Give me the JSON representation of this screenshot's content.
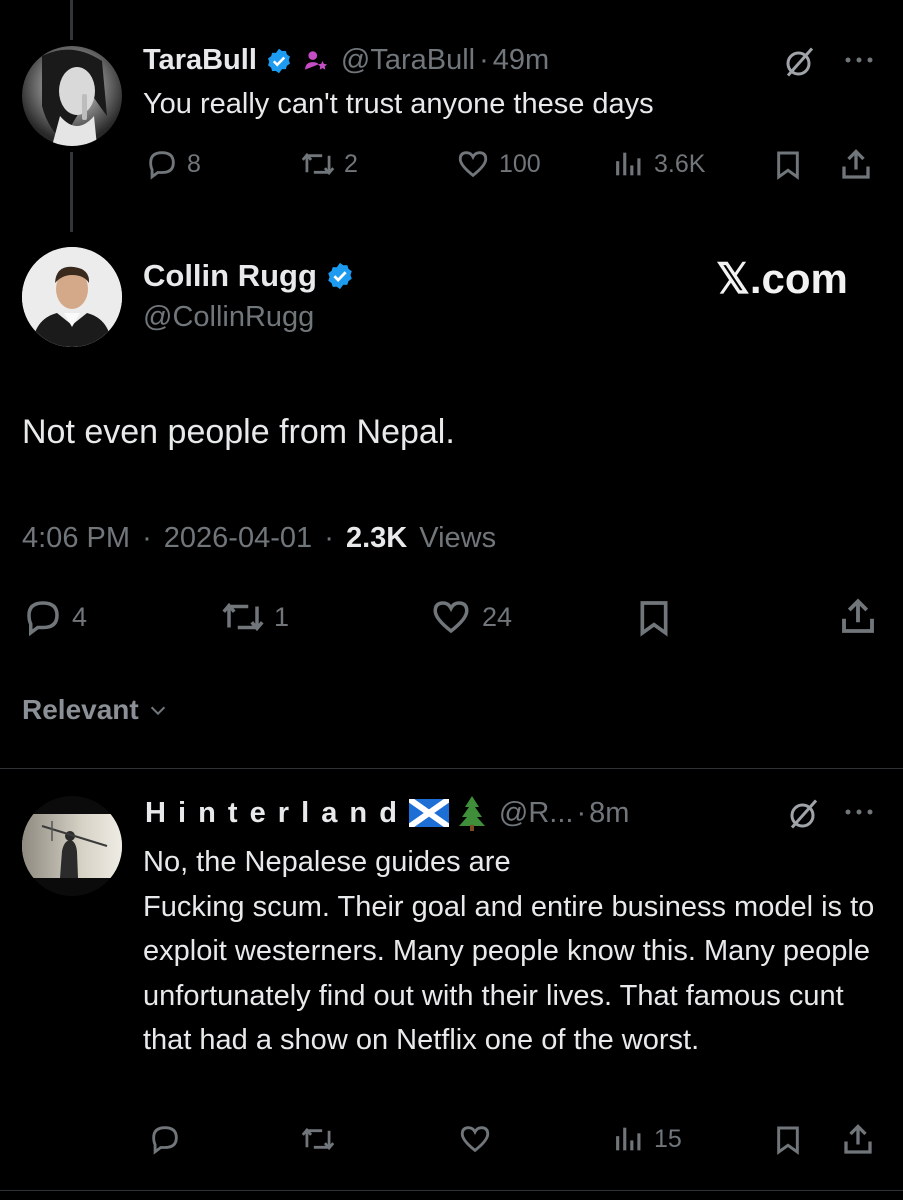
{
  "parent_tweet": {
    "display_name": "TaraBull",
    "handle": "@TaraBull",
    "separator": "·",
    "time": "49m",
    "text": "You really can't trust anyone these days",
    "replies": "8",
    "reposts": "2",
    "likes": "100",
    "views": "3.6K"
  },
  "main_tweet": {
    "display_name": "Collin Rugg",
    "handle": "@CollinRugg",
    "watermark": "𝕏.com",
    "text": "Not even people from Nepal.",
    "time": "4:06 PM",
    "separator1": "·",
    "date": "2026-04-01",
    "separator2": "·",
    "views_count": "2.3K",
    "views_label": "Views",
    "replies": "4",
    "reposts": "1",
    "likes": "24"
  },
  "sort": {
    "label": "Relevant"
  },
  "reply_tweet": {
    "display_name": "H i n t e r l a n d",
    "flag_emoji": "🏴󠁧󠁢󠁳󠁣󠁴󠁿",
    "tree_emoji": "🌲",
    "handle": "@R...",
    "separator": "·",
    "time": "8m",
    "text": "No, the Nepalese guides are\nFucking scum. Their goal and entire business model is to exploit westerners. Many people know this. Many people unfortunately find out with their lives. That famous cunt that had a show on Netflix one of the worst.",
    "views": "15"
  },
  "colors": {
    "background": "#000000",
    "text": "#e7e9ea",
    "muted": "#71767b",
    "verified_blue": "#1d9bf0",
    "affiliate_purple": "#c44cc4",
    "divider": "#2f3336"
  }
}
